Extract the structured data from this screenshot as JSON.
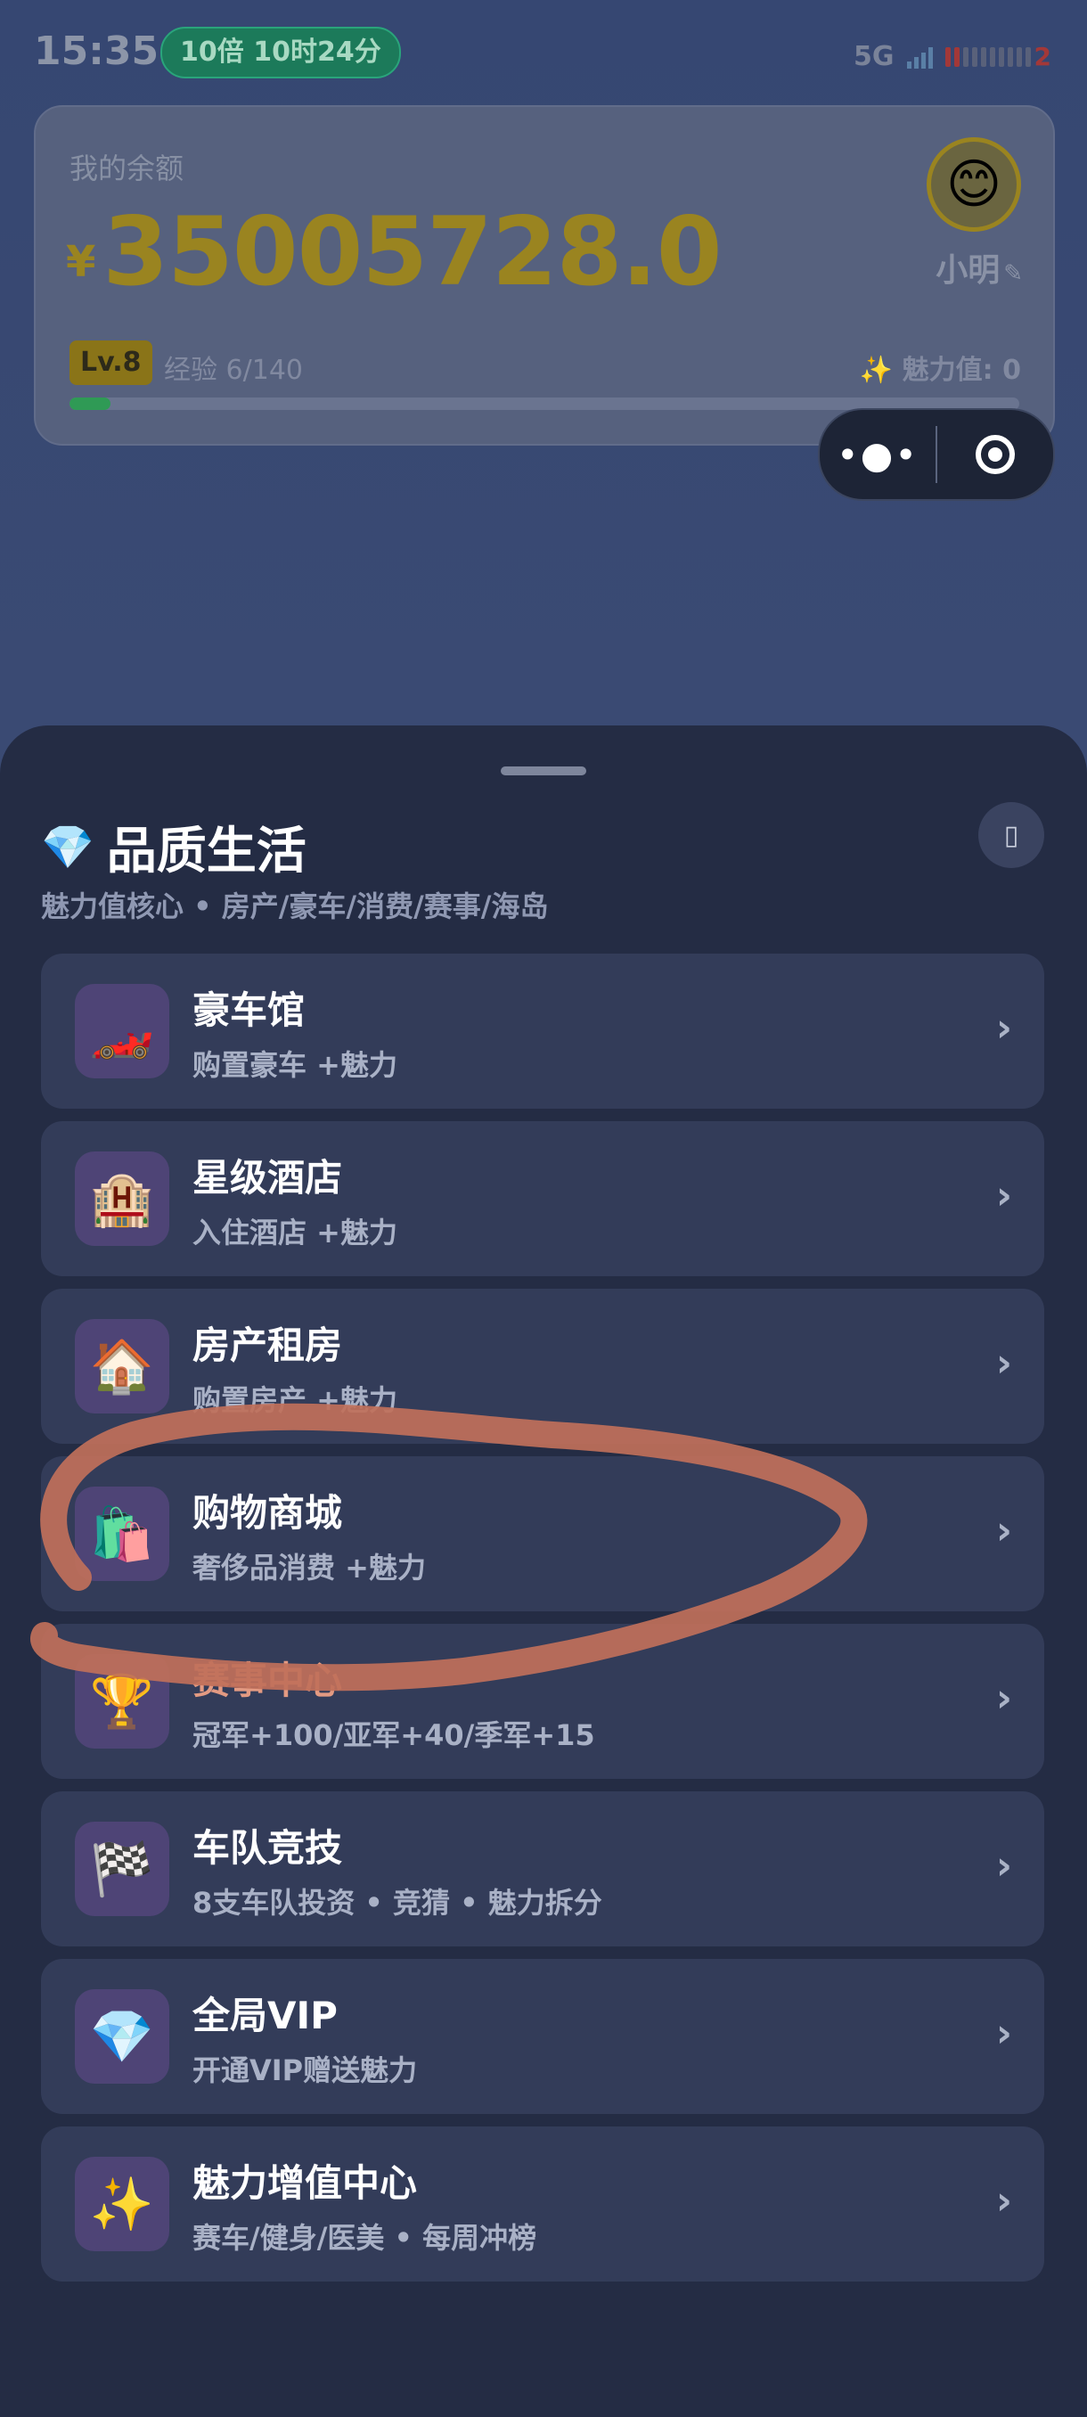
{
  "status_bar": {
    "time": "15:35",
    "pill": "10倍 10时24分",
    "network": "5G",
    "battery_level": "2"
  },
  "balance_card": {
    "label": "我的余额",
    "currency": "¥",
    "amount": "35005728.0",
    "username": "小明",
    "edit_icon": "pencil-icon",
    "level": "Lv.8",
    "experience": "经验 6/140",
    "experience_progress": 0.043,
    "charm_icon": "sparkle-icon",
    "charm": "魅力值: 0"
  },
  "capsule": {
    "more_icon": "more-dots-icon",
    "close_icon": "target-icon"
  },
  "sheet": {
    "title_icon": "gem-icon",
    "title": "品质生活",
    "subtitle": "魅力值核心 • 房产/豪车/消费/赛事/海岛",
    "close_icon": "close-icon",
    "items": [
      {
        "icon": "race-car-icon",
        "title": "豪车馆",
        "desc": "购置豪车 +魅力"
      },
      {
        "icon": "hotel-icon",
        "title": "星级酒店",
        "desc": "入住酒店 +魅力"
      },
      {
        "icon": "house-icon",
        "title": "房产租房",
        "desc": "购置房产 +魅力"
      },
      {
        "icon": "shopping-bags-icon",
        "title": "购物商城",
        "desc": "奢侈品消费 +魅力"
      },
      {
        "icon": "trophy-icon",
        "title": "赛事中心",
        "desc": "冠军+100/亚军+40/季军+15"
      },
      {
        "icon": "checkered-flag-icon",
        "title": "车队竞技",
        "desc": "8支车队投资 • 竞猜 • 魅力拆分"
      },
      {
        "icon": "gem-icon",
        "title": "全局VIP",
        "desc": "开通VIP赠送魅力"
      },
      {
        "icon": "sparkles-icon",
        "title": "魅力增值中心",
        "desc": "赛车/健身/医美 • 每周冲榜"
      }
    ]
  },
  "colors": {
    "amount": "#9a8420",
    "sheet_bg": "#242c44",
    "item_bg": "#333c59",
    "annotation": "#c0705a"
  }
}
